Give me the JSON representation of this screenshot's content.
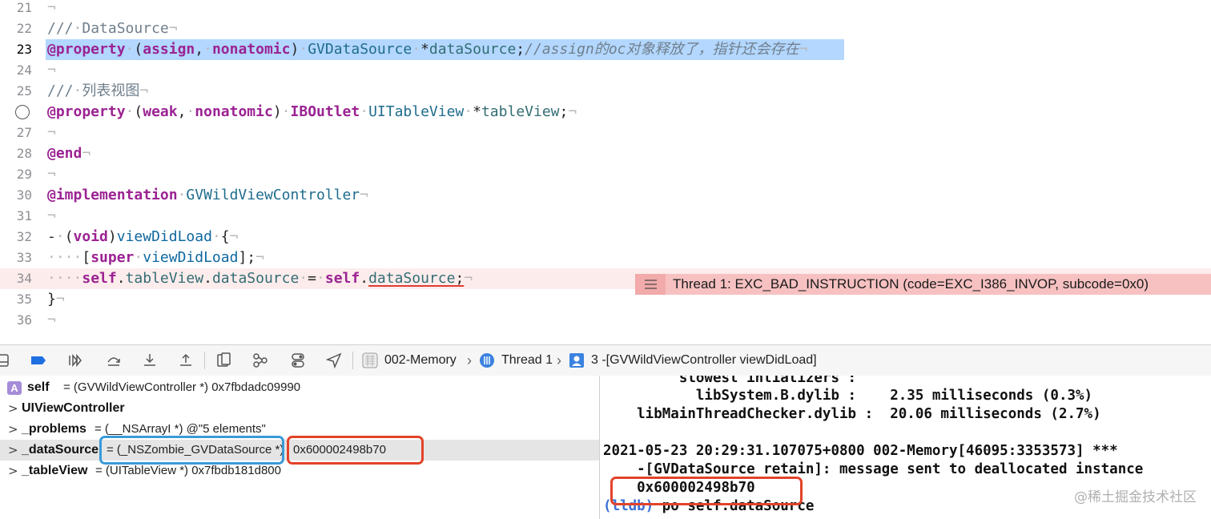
{
  "editor": {
    "lines": [
      {
        "n": "21",
        "code": [
          {
            "t": "¬",
            "c": "inv"
          }
        ]
      },
      {
        "n": "22",
        "code": [
          {
            "t": "///",
            "c": "cmt"
          },
          {
            "t": "·",
            "c": "inv"
          },
          {
            "t": "DataSource",
            "c": "cmt"
          },
          {
            "t": "¬",
            "c": "inv"
          }
        ]
      },
      {
        "n": "23",
        "current": true,
        "selected": true,
        "code": [
          {
            "t": "@property",
            "c": "kw"
          },
          {
            "t": "·",
            "c": "inv"
          },
          {
            "t": "(",
            "c": ""
          },
          {
            "t": "assign",
            "c": "kw"
          },
          {
            "t": ",",
            "c": ""
          },
          {
            "t": "·",
            "c": "inv"
          },
          {
            "t": "nonatomic",
            "c": "kw"
          },
          {
            "t": ")",
            "c": ""
          },
          {
            "t": "·",
            "c": "inv"
          },
          {
            "t": "GVDataSource",
            "c": "typ"
          },
          {
            "t": "·",
            "c": "inv"
          },
          {
            "t": "*",
            "c": ""
          },
          {
            "t": "dataSource",
            "c": "ivar"
          },
          {
            "t": ";",
            "c": ""
          },
          {
            "t": "//assign的oc对象释放了，指针还会存在",
            "c": "cmt-i"
          },
          {
            "t": "¬",
            "c": "inv"
          }
        ]
      },
      {
        "n": "24",
        "code": [
          {
            "t": "¬",
            "c": "inv"
          }
        ]
      },
      {
        "n": "25",
        "code": [
          {
            "t": "///",
            "c": "cmt"
          },
          {
            "t": "·",
            "c": "inv"
          },
          {
            "t": "列表视图",
            "c": "cmt"
          },
          {
            "t": "¬",
            "c": "inv"
          }
        ]
      },
      {
        "n": "",
        "circle": true,
        "code": [
          {
            "t": "@property",
            "c": "kw"
          },
          {
            "t": "·",
            "c": "inv"
          },
          {
            "t": "(",
            "c": ""
          },
          {
            "t": "weak",
            "c": "kw"
          },
          {
            "t": ",",
            "c": ""
          },
          {
            "t": "·",
            "c": "inv"
          },
          {
            "t": "nonatomic",
            "c": "kw"
          },
          {
            "t": ")",
            "c": ""
          },
          {
            "t": "·",
            "c": "inv"
          },
          {
            "t": "IBOutlet",
            "c": "kw"
          },
          {
            "t": "·",
            "c": "inv"
          },
          {
            "t": "UITableView",
            "c": "typ"
          },
          {
            "t": "·",
            "c": "inv"
          },
          {
            "t": "*",
            "c": ""
          },
          {
            "t": "tableView",
            "c": "ivar"
          },
          {
            "t": ";",
            "c": ""
          },
          {
            "t": "¬",
            "c": "inv"
          }
        ]
      },
      {
        "n": "27",
        "code": [
          {
            "t": "¬",
            "c": "inv"
          }
        ]
      },
      {
        "n": "28",
        "code": [
          {
            "t": "@end",
            "c": "kw"
          },
          {
            "t": "¬",
            "c": "inv"
          }
        ]
      },
      {
        "n": "29",
        "code": [
          {
            "t": "¬",
            "c": "inv"
          }
        ]
      },
      {
        "n": "30",
        "code": [
          {
            "t": "@implementation",
            "c": "kw"
          },
          {
            "t": "·",
            "c": "inv"
          },
          {
            "t": "GVWildViewController",
            "c": "typ"
          },
          {
            "t": "¬",
            "c": "inv"
          }
        ]
      },
      {
        "n": "31",
        "code": [
          {
            "t": "¬",
            "c": "inv"
          }
        ]
      },
      {
        "n": "32",
        "code": [
          {
            "t": "-",
            "c": ""
          },
          {
            "t": "·",
            "c": "inv"
          },
          {
            "t": "(",
            "c": ""
          },
          {
            "t": "void",
            "c": "kw"
          },
          {
            "t": ")",
            "c": ""
          },
          {
            "t": "viewDidLoad",
            "c": "method"
          },
          {
            "t": "·",
            "c": "inv"
          },
          {
            "t": "{",
            "c": ""
          },
          {
            "t": "¬",
            "c": "inv"
          }
        ]
      },
      {
        "n": "33",
        "code": [
          {
            "t": "····",
            "c": "inv"
          },
          {
            "t": "[",
            "c": ""
          },
          {
            "t": "super",
            "c": "kw"
          },
          {
            "t": "·",
            "c": "inv"
          },
          {
            "t": "viewDidLoad",
            "c": "method"
          },
          {
            "t": "];",
            "c": ""
          },
          {
            "t": "¬",
            "c": "inv"
          }
        ]
      },
      {
        "n": "34",
        "error": true,
        "code": [
          {
            "t": "····",
            "c": "inv"
          },
          {
            "t": "self",
            "c": "kw"
          },
          {
            "t": ".",
            "c": ""
          },
          {
            "t": "tableView",
            "c": "ivar"
          },
          {
            "t": ".",
            "c": ""
          },
          {
            "t": "dataSource",
            "c": "ivar"
          },
          {
            "t": "·",
            "c": "inv"
          },
          {
            "t": "=",
            "c": ""
          },
          {
            "t": "·",
            "c": "inv"
          },
          {
            "t": "self",
            "c": "kw"
          },
          {
            "t": ".",
            "c": ""
          },
          {
            "t": "dataSource",
            "c": "ivar squig"
          },
          {
            "t": ";",
            "c": "squig"
          },
          {
            "t": "¬",
            "c": "inv"
          }
        ]
      },
      {
        "n": "35",
        "code": [
          {
            "t": "}",
            "c": ""
          },
          {
            "t": "¬",
            "c": "inv"
          }
        ]
      },
      {
        "n": "36",
        "code": [
          {
            "t": "¬",
            "c": "inv"
          }
        ]
      }
    ],
    "error_message": "Thread 1: EXC_BAD_INSTRUCTION (code=EXC_I386_INVOP, subcode=0x0)"
  },
  "debug_bar": {
    "scheme": "002-Memory",
    "thread": "Thread 1",
    "frame": "3 -[GVWildViewController viewDidLoad]",
    "icons": [
      "hide-panel-icon",
      "breakpoint-toggle-icon",
      "continue-icon",
      "step-over-icon",
      "step-into-icon",
      "step-out-icon",
      "view-hierarchy-icon",
      "memory-graph-icon",
      "environment-overrides-icon",
      "location-icon"
    ]
  },
  "variables": [
    {
      "badge": "A",
      "name": "self",
      "value": "= (GVWildViewController *) 0x7fbdadc09990"
    },
    {
      "chevron": ">",
      "name": "UIViewController",
      "value": ""
    },
    {
      "chevron": ">",
      "name": "_problems",
      "value": "= (__NSArrayI *) @\"5 elements\""
    },
    {
      "chevron": ">",
      "name": "_dataSource",
      "type_value": "= (_NSZombie_GVDataSource *)",
      "addr": "0x600002498b70",
      "selected": true
    },
    {
      "chevron": ">",
      "name": "_tableView",
      "value": "= (UITableView *) 0x7fbdb181d800"
    }
  ],
  "console": {
    "lines": [
      "         slowest intializers :",
      "           libSystem.B.dylib :    2.35 milliseconds (0.3%)",
      "    libMainThreadChecker.dylib :  20.06 milliseconds (2.7%)",
      "",
      "2021-05-23 20:29:31.107075+0800 002-Memory[46095:3353573] ***",
      "    -[GVDataSource retain]: message sent to deallocated instance",
      "    0x600002498b70"
    ],
    "prompt": "(lldb)",
    "command": " po self.dataSource"
  },
  "watermark": "@稀土掘金技术社区",
  "colors": {
    "keyword": "#9b2393",
    "type": "#1f6c8c",
    "selection": "#b3d7ff",
    "error_bg": "#fdecec",
    "error_badge": "#f7c1c1",
    "annotation_red": "#e2432a",
    "annotation_blue": "#3a9ad9"
  }
}
